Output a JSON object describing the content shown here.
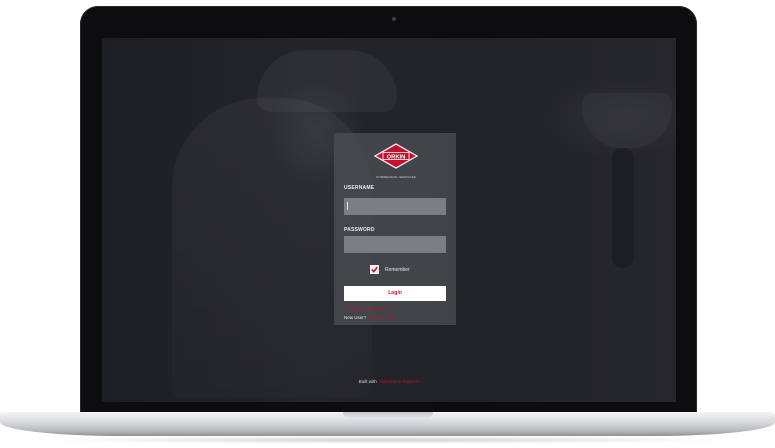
{
  "brand": {
    "logo_text": "ORKIN",
    "tagline": "COMMERCIAL SERVICES",
    "logo_red": "#c8102e"
  },
  "login": {
    "username_label": "USERNAME",
    "username_value": "",
    "password_label": "PASSWORD",
    "password_value": "",
    "remember_label": "Remember",
    "remember_checked": true,
    "login_button": "Login",
    "forgot_link": "Forgot your password?",
    "new_user_text": "New User?",
    "register_link": "Register Now"
  },
  "footer": {
    "built_with": "Built with",
    "platform_link": "Salesforce Platform"
  },
  "icons": {
    "checkbox": "check-icon",
    "camera": "camera-icon"
  }
}
